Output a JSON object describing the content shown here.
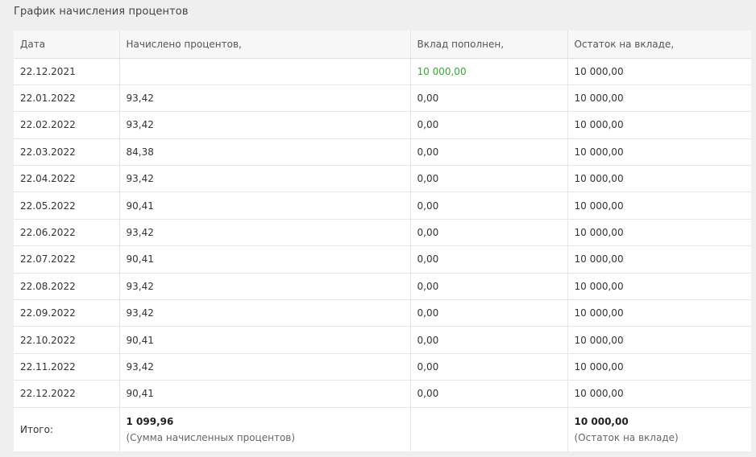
{
  "panel": {
    "title": "График начисления процентов"
  },
  "table": {
    "headers": [
      "Дата",
      "Начислено процентов,",
      "Вклад пополнен,",
      "Остаток на вкладе,"
    ],
    "rows": [
      [
        "22.12.2021",
        "",
        "10 000,00",
        "10 000,00"
      ],
      [
        "22.01.2022",
        "93,42",
        "0,00",
        "10 000,00"
      ],
      [
        "22.02.2022",
        "93,42",
        "0,00",
        "10 000,00"
      ],
      [
        "22.03.2022",
        "84,38",
        "0,00",
        "10 000,00"
      ],
      [
        "22.04.2022",
        "93,42",
        "0,00",
        "10 000,00"
      ],
      [
        "22.05.2022",
        "90,41",
        "0,00",
        "10 000,00"
      ],
      [
        "22.06.2022",
        "93,42",
        "0,00",
        "10 000,00"
      ],
      [
        "22.07.2022",
        "90,41",
        "0,00",
        "10 000,00"
      ],
      [
        "22.08.2022",
        "93,42",
        "0,00",
        "10 000,00"
      ],
      [
        "22.09.2022",
        "93,42",
        "0,00",
        "10 000,00"
      ],
      [
        "22.10.2022",
        "90,41",
        "0,00",
        "10 000,00"
      ],
      [
        "22.11.2022",
        "93,42",
        "0,00",
        "10 000,00"
      ],
      [
        "22.12.2022",
        "90,41",
        "0,00",
        "10 000,00"
      ]
    ],
    "total": {
      "label": "Итого:",
      "interest_value": "1 099,96",
      "interest_caption": "(Сумма начисленных процентов)",
      "balance_value": "10 000,00",
      "balance_caption": "(Остаток на вкладе)"
    }
  },
  "colors": {
    "deposit_highlight": "#3aa53a",
    "background": "#efefef"
  }
}
